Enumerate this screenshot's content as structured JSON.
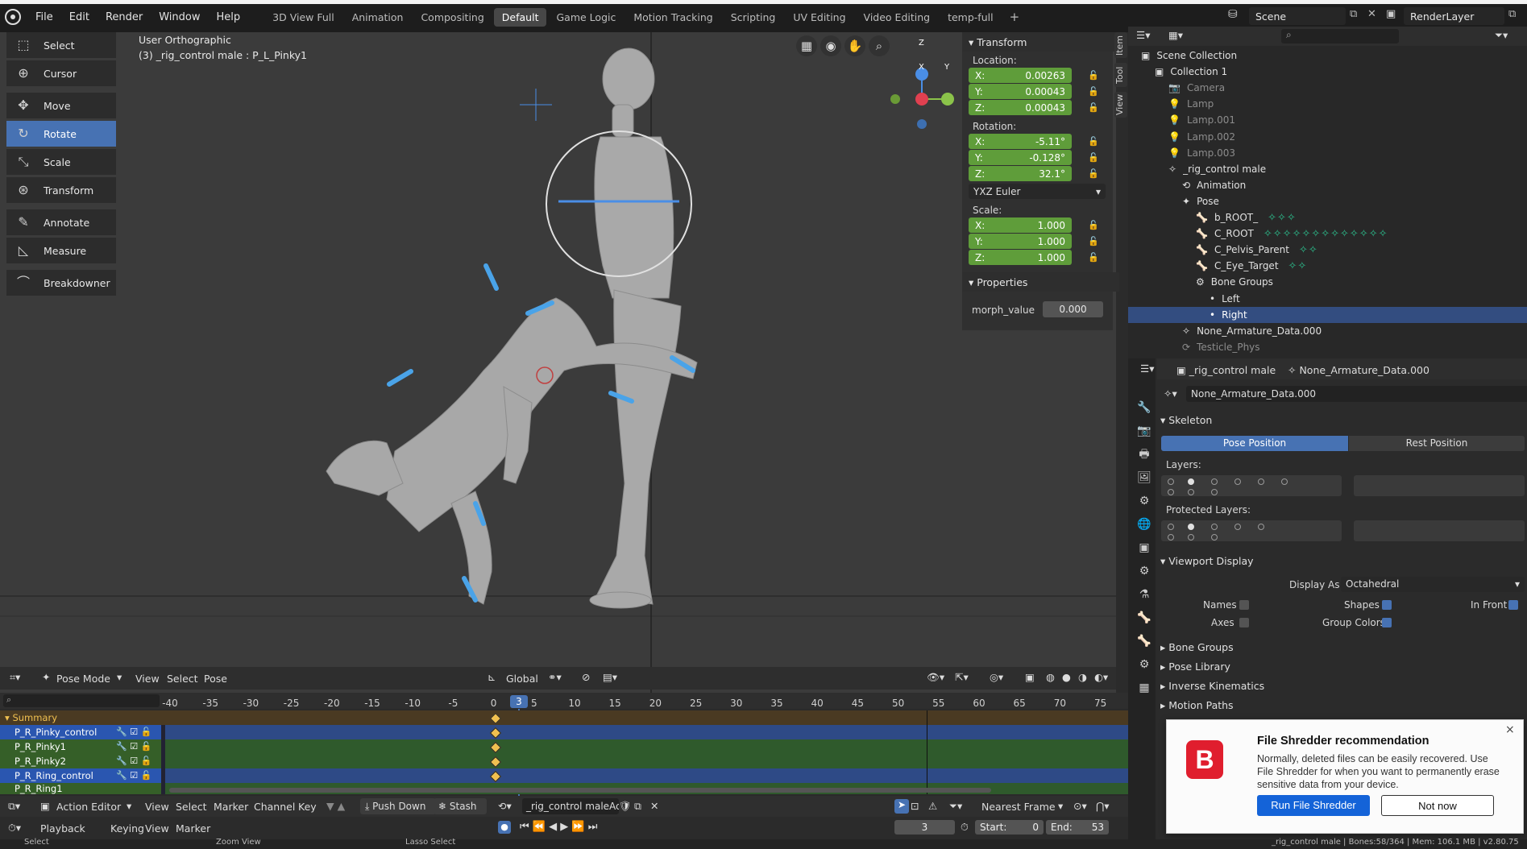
{
  "menu": [
    "File",
    "Edit",
    "Render",
    "Window",
    "Help"
  ],
  "workspaces": [
    "3D View Full",
    "Animation",
    "Compositing",
    "Default",
    "Game Logic",
    "Motion Tracking",
    "Scripting",
    "UV Editing",
    "Video Editing",
    "temp-full"
  ],
  "active_workspace": "Default",
  "scene": "Scene",
  "render_layer": "RenderLayer",
  "viewport": {
    "view_name": "User Orthographic",
    "active_object": "(3) _rig_control male : P_L_Pinky1",
    "tools": [
      "Select",
      "Cursor",
      "Move",
      "Rotate",
      "Scale",
      "Transform",
      "Annotate",
      "Measure",
      "Breakdowner"
    ],
    "active_tool": "Rotate",
    "header": {
      "mode": "Pose Mode",
      "view": "View",
      "select": "Select",
      "pose": "Pose",
      "orientation": "Global"
    },
    "side_tabs": [
      "Item",
      "Tool",
      "View"
    ],
    "gizmo": {
      "x": "X",
      "y": "Y",
      "z": "Z"
    }
  },
  "transform": {
    "title": "Transform",
    "location_label": "Location:",
    "location": [
      {
        "axis": "X:",
        "value": "0.00263"
      },
      {
        "axis": "Y:",
        "value": "0.00043"
      },
      {
        "axis": "Z:",
        "value": "0.00043"
      }
    ],
    "rotation_label": "Rotation:",
    "rotation": [
      {
        "axis": "X:",
        "value": "-5.11°"
      },
      {
        "axis": "Y:",
        "value": "-0.128°"
      },
      {
        "axis": "Z:",
        "value": "32.1°"
      }
    ],
    "rotation_mode": "YXZ Euler",
    "scale_label": "Scale:",
    "scale": [
      {
        "axis": "X:",
        "value": "1.000"
      },
      {
        "axis": "Y:",
        "value": "1.000"
      },
      {
        "axis": "Z:",
        "value": "1.000"
      }
    ],
    "properties_title": "Properties",
    "morph_label": "morph_value",
    "morph_value": "0.000"
  },
  "dopesheet": {
    "ticks": [
      "-40",
      "-35",
      "-30",
      "-25",
      "-20",
      "-15",
      "-10",
      "-5",
      "0",
      "5",
      "10",
      "15",
      "20",
      "25",
      "30",
      "35",
      "40",
      "45",
      "50",
      "55",
      "60",
      "65",
      "70",
      "75"
    ],
    "current_frame": "3",
    "summary": "Summary",
    "channels": [
      "P_R_Pinky_control",
      "P_R_Pinky1",
      "P_R_Pinky2",
      "P_R_Ring_control",
      "P_R_Ring1"
    ],
    "editor": "Action Editor",
    "menus": [
      "View",
      "Select",
      "Marker",
      "Channel",
      "Key"
    ],
    "push_down": "Push Down",
    "stash": "Stash",
    "action": "_rig_control maleAc...",
    "snap": "Nearest Frame"
  },
  "timeline": {
    "playback": "Playback",
    "keying": "Keying",
    "view": "View",
    "marker": "Marker",
    "frame": "3",
    "start_label": "Start:",
    "start": "0",
    "end_label": "End:",
    "end": "53"
  },
  "outliner": {
    "items": [
      {
        "label": "Scene Collection",
        "depth": 0,
        "dim": false
      },
      {
        "label": "Collection 1",
        "depth": 1,
        "dim": false
      },
      {
        "label": "Camera",
        "depth": 2,
        "dim": true
      },
      {
        "label": "Lamp",
        "depth": 2,
        "dim": true
      },
      {
        "label": "Lamp.001",
        "depth": 2,
        "dim": true
      },
      {
        "label": "Lamp.002",
        "depth": 2,
        "dim": true
      },
      {
        "label": "Lamp.003",
        "depth": 2,
        "dim": true
      },
      {
        "label": "_rig_control male",
        "depth": 2,
        "dim": false
      },
      {
        "label": "Animation",
        "depth": 3,
        "dim": false
      },
      {
        "label": "Pose",
        "depth": 3,
        "dim": false
      },
      {
        "label": "b_ROOT_",
        "depth": 4,
        "dim": false
      },
      {
        "label": "C_ROOT",
        "depth": 4,
        "dim": false
      },
      {
        "label": "C_Pelvis_Parent",
        "depth": 4,
        "dim": false
      },
      {
        "label": "C_Eye_Target",
        "depth": 4,
        "dim": false
      },
      {
        "label": "Bone Groups",
        "depth": 4,
        "dim": false
      },
      {
        "label": "Left",
        "depth": 5,
        "dim": false
      },
      {
        "label": "Right",
        "depth": 5,
        "dim": false
      },
      {
        "label": "None_Armature_Data.000",
        "depth": 3,
        "dim": false
      },
      {
        "label": "Testicle_Phys",
        "depth": 3,
        "dim": true
      }
    ],
    "selected": "Right"
  },
  "properties": {
    "object": "_rig_control male",
    "data": "None_Armature_Data.000",
    "data_field": "None_Armature_Data.000",
    "skeleton": "Skeleton",
    "pose_position": "Pose Position",
    "rest_position": "Rest Position",
    "layers": "Layers:",
    "protected_layers": "Protected Layers:",
    "viewport_display": "Viewport Display",
    "display_as_label": "Display As",
    "display_as": "Octahedral",
    "names": "Names",
    "shapes": "Shapes",
    "in_front": "In Front",
    "axes": "Axes",
    "group_colors": "Group Colors",
    "sections": [
      "Bone Groups",
      "Pose Library",
      "Inverse Kinematics",
      "Motion Paths"
    ]
  },
  "toast": {
    "title": "File Shredder recommendation",
    "body": "Normally, deleted files can be easily recovered. Use File Shredder for when you want to permanently erase sensitive data from your device.",
    "primary": "Run File Shredder",
    "secondary": "Not now",
    "close": "×"
  },
  "status": {
    "select": "Select",
    "zoom": "Zoom View",
    "lasso": "Lasso Select",
    "stats": "_rig_control male | Bones:58/364 | Mem: 106.1 MB | v2.80.75"
  },
  "colors": {
    "accent": "#4772b3",
    "field_green": "#5f9d3a",
    "bone_teal": "#2cc08e",
    "keyframe": "#f0c050"
  }
}
